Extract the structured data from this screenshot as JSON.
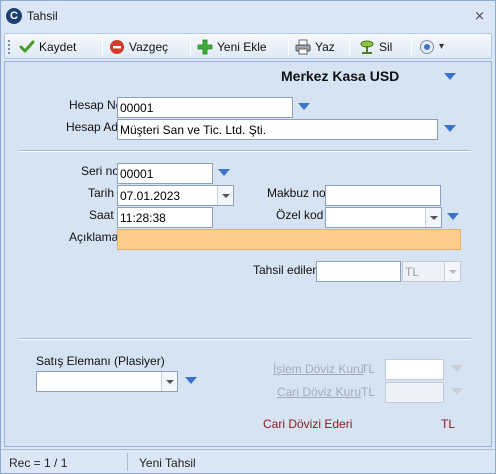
{
  "window": {
    "title": "Tahsil",
    "logo_letter": "C",
    "close_glyph": "⨯"
  },
  "toolbar": {
    "save_label": "Kaydet",
    "cancel_label": "Vazgeç",
    "new_label": "Yeni Ekle",
    "print_label": "Yaz",
    "delete_label": "Sil",
    "options_arrow": "▾"
  },
  "header": {
    "kasa_name": "Merkez Kasa USD"
  },
  "account": {
    "hesap_no_label": "Hesap No",
    "hesap_no_value": "00001",
    "hesap_adi_label": "Hesap Adı",
    "hesap_adi_value": "Müşteri San ve Tic. Ltd. Şti."
  },
  "document": {
    "seri_no_label": "Seri no",
    "seri_no_value": "00001",
    "tarih_label": "Tarih",
    "tarih_value": "07.01.2023",
    "saat_label": "Saat",
    "saat_value": "11:28:38",
    "makbuz_no_label": "Makbuz no",
    "makbuz_no_value": "",
    "ozel_kod_label": "Özel kod",
    "ozel_kod_value": "",
    "aciklama_label": "Açıklama",
    "aciklama_value": ""
  },
  "amount": {
    "tahsil_edilen_label": "Tahsil edilen",
    "tahsil_edilen_value": "",
    "currency_value": "TL"
  },
  "sales": {
    "satis_elemani_label": "Satış Elemanı (Plasiyer)",
    "satis_elemani_value": "",
    "islem_doviz_kuru_label": "İşlem Döviz Kuru",
    "islem_doviz_currency": "TL",
    "islem_doviz_value": "",
    "cari_doviz_kuru_label": "Cari Döviz Kuru",
    "cari_doviz_currency": "TL",
    "cari_doviz_value": "",
    "cari_dovizi_ederi_label": "Cari Dövizi Ederi",
    "cari_dovizi_ederi_currency": "TL"
  },
  "status": {
    "record": "Rec = 1 / 1",
    "mode": "Yeni Tahsil"
  },
  "colors": {
    "accent": "#3a73c8",
    "aciklama_bg": "#ffce8f",
    "ederi_label": "#8b1a1a"
  },
  "icons": [
    "check-icon",
    "cancel-icon",
    "add-icon",
    "printer-icon",
    "delete-icon",
    "options-icon",
    "dropdown-triangle-icon"
  ]
}
